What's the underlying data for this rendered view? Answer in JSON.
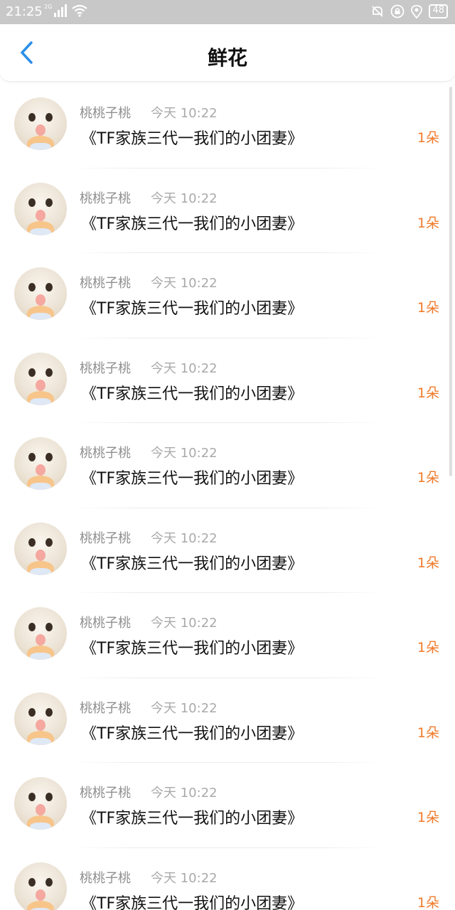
{
  "status_bar": {
    "time": "21:25",
    "network": "2G",
    "battery": "48",
    "icons": [
      "signal-icon",
      "wifi-icon",
      "mute-icon",
      "lock-icon",
      "location-icon",
      "battery-icon"
    ]
  },
  "header": {
    "title": "鲜花",
    "back_icon": "chevron-left-icon",
    "accent": "#2b8fe8"
  },
  "colors": {
    "count": "#f07a2a",
    "name": "#8f8f8f",
    "time": "#aaaaaa"
  },
  "items": [
    {
      "user": "桃桃子桃",
      "time": "今天 10:22",
      "title": "《TF家族三代一我们的小团妻》",
      "count": "1朵"
    },
    {
      "user": "桃桃子桃",
      "time": "今天 10:22",
      "title": "《TF家族三代一我们的小团妻》",
      "count": "1朵"
    },
    {
      "user": "桃桃子桃",
      "time": "今天 10:22",
      "title": "《TF家族三代一我们的小团妻》",
      "count": "1朵"
    },
    {
      "user": "桃桃子桃",
      "time": "今天 10:22",
      "title": "《TF家族三代一我们的小团妻》",
      "count": "1朵"
    },
    {
      "user": "桃桃子桃",
      "time": "今天 10:22",
      "title": "《TF家族三代一我们的小团妻》",
      "count": "1朵"
    },
    {
      "user": "桃桃子桃",
      "time": "今天 10:22",
      "title": "《TF家族三代一我们的小团妻》",
      "count": "1朵"
    },
    {
      "user": "桃桃子桃",
      "time": "今天 10:22",
      "title": "《TF家族三代一我们的小团妻》",
      "count": "1朵"
    },
    {
      "user": "桃桃子桃",
      "time": "今天 10:22",
      "title": "《TF家族三代一我们的小团妻》",
      "count": "1朵"
    },
    {
      "user": "桃桃子桃",
      "time": "今天 10:22",
      "title": "《TF家族三代一我们的小团妻》",
      "count": "1朵"
    },
    {
      "user": "桃桃子桃",
      "time": "今天 10:22",
      "title": "《TF家族三代一我们的小团妻》",
      "count": "1朵"
    }
  ]
}
